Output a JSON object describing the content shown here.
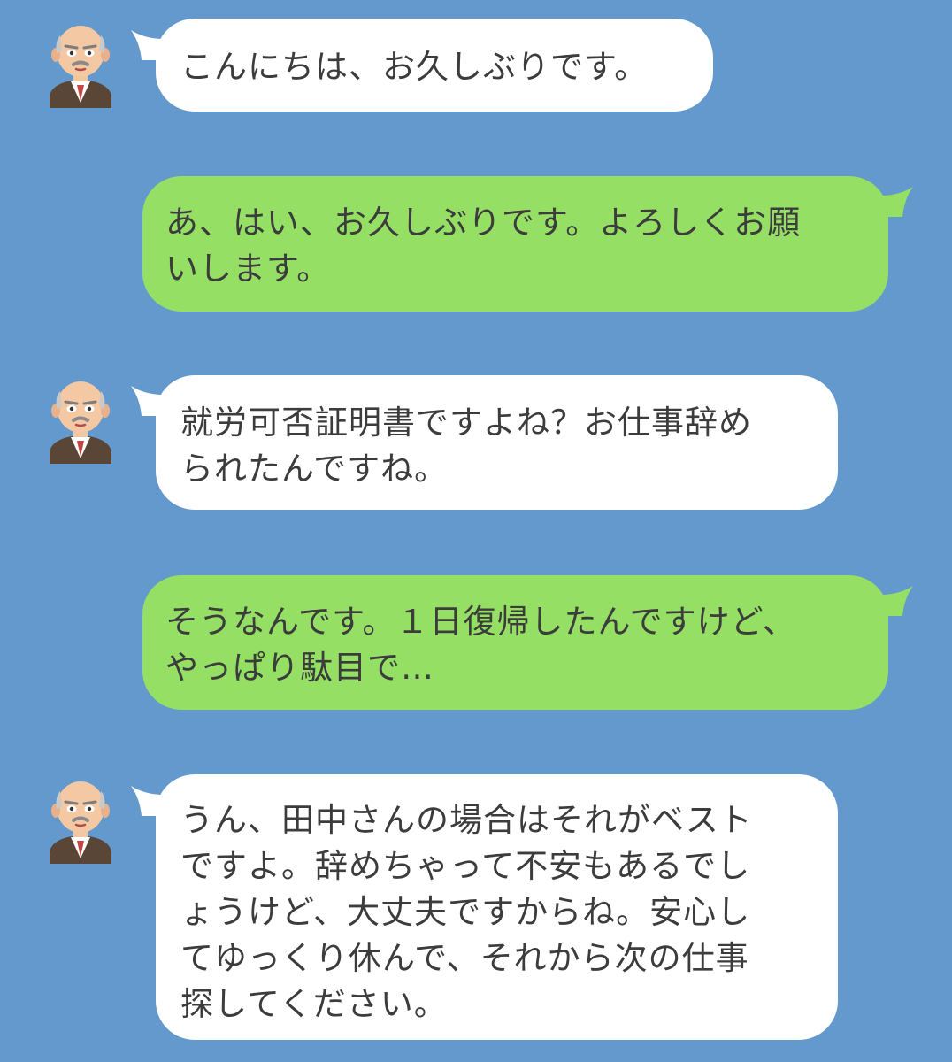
{
  "chat": {
    "messages": [
      {
        "sender": "other",
        "text": "こんにちは、お久しぶりです。"
      },
      {
        "sender": "me",
        "text": "あ、はい、お久しぶりです。よろしくお願\nいします。"
      },
      {
        "sender": "other",
        "text": "就労可否証明書ですよね？お仕事辞め\nられたんですね。"
      },
      {
        "sender": "me",
        "text": "そうなんです。１日復帰したんですけど、\nやっぱり駄目で…"
      },
      {
        "sender": "other",
        "text": "うん、田中さんの場合はそれがベスト\nですよ。辞めちゃって不安もあるでし\nょうけど、大丈夫ですからね。安心し\nてゆっくり休んで、それから次の仕事\n探してください。"
      }
    ]
  },
  "colors": {
    "background": "#6399cc",
    "received_bubble": "#ffffff",
    "sent_bubble": "#94df64",
    "text": "#3c3c3c"
  },
  "icons": {
    "avatar": "elderly-doctor-avatar-icon"
  }
}
